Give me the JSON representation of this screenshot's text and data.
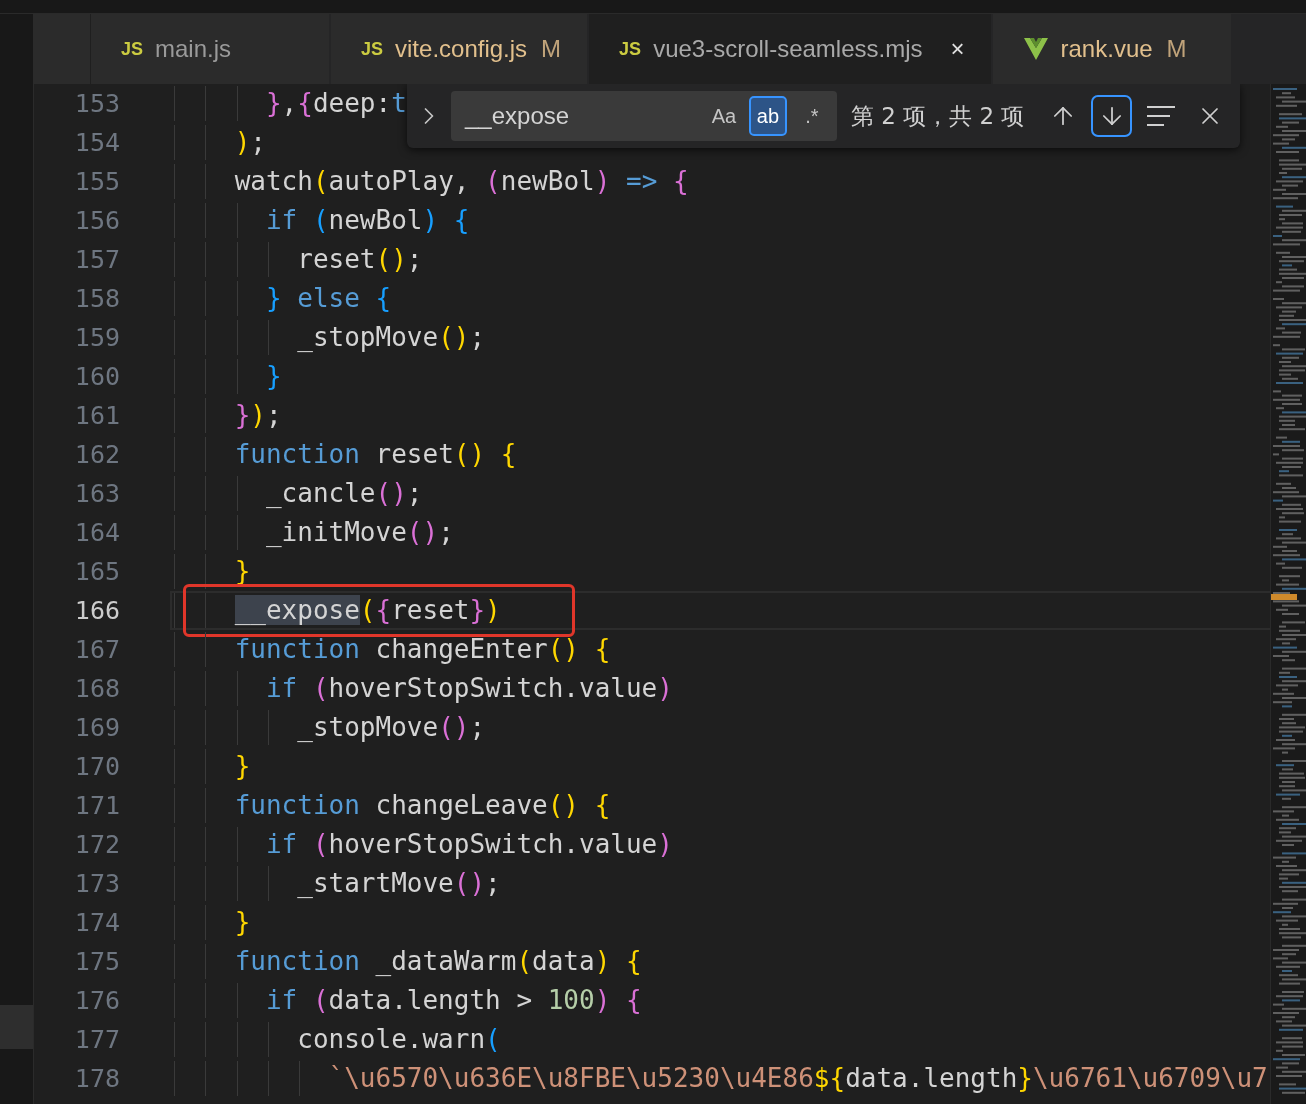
{
  "tabs": [
    {
      "kind": "js",
      "icon_text": "JS",
      "label": "main.js",
      "selected": false
    },
    {
      "kind": "js",
      "icon_text": "JS",
      "label": "vite.config.js",
      "badge": "M",
      "selected": false
    },
    {
      "kind": "js",
      "icon_text": "JS",
      "label": "vue3-scroll-seamless.mjs",
      "selected": true,
      "close": "×"
    },
    {
      "kind": "vue",
      "label": "rank.vue",
      "badge": "M",
      "selected": false
    }
  ],
  "find_widget": {
    "value": "__expose",
    "options": [
      {
        "label": "Aa",
        "selected": false
      },
      {
        "label": "ab",
        "selected": true
      },
      {
        "label": ".*",
        "selected": false
      }
    ],
    "match_count": "第 2 项，共 2 项",
    "buttons": [
      {
        "kind": "previous",
        "focused": false
      },
      {
        "kind": "next",
        "focused": true
      },
      {
        "kind": "selection",
        "focused": false
      },
      {
        "kind": "close",
        "focused": false
      }
    ]
  },
  "lines": [
    {
      "number": "153",
      "current": false,
      "tokens": [
        {
          "text": "      }",
          "kind": "p2"
        },
        {
          "text": ",",
          "kind": "t"
        },
        {
          "text": "{",
          "kind": "p2"
        },
        {
          "text": "deep:",
          "kind": "t"
        },
        {
          "text": "t",
          "kind": "k"
        }
      ]
    },
    {
      "number": "154",
      "current": false,
      "tokens": [
        {
          "text": "    )",
          "kind": "p1"
        },
        {
          "text": ";",
          "kind": "t"
        }
      ]
    },
    {
      "number": "155",
      "current": false,
      "tokens": [
        {
          "text": "    watch",
          "kind": "t"
        },
        {
          "text": "(",
          "kind": "p1"
        },
        {
          "text": "autoPlay, ",
          "kind": "t"
        },
        {
          "text": "(",
          "kind": "p2"
        },
        {
          "text": "newBol",
          "kind": "t"
        },
        {
          "text": ")",
          "kind": "p2"
        },
        {
          "text": " =>",
          "kind": "k"
        },
        {
          "text": " {",
          "kind": "p2"
        }
      ]
    },
    {
      "number": "156",
      "current": false,
      "tokens": [
        {
          "text": "      if",
          "kind": "k"
        },
        {
          "text": " (",
          "kind": "p3"
        },
        {
          "text": "newBol",
          "kind": "t"
        },
        {
          "text": ")",
          "kind": "p3"
        },
        {
          "text": " {",
          "kind": "p3"
        }
      ]
    },
    {
      "number": "157",
      "current": false,
      "tokens": [
        {
          "text": "        reset",
          "kind": "t"
        },
        {
          "text": "()",
          "kind": "p1"
        },
        {
          "text": ";",
          "kind": "t"
        }
      ]
    },
    {
      "number": "158",
      "current": false,
      "tokens": [
        {
          "text": "      }",
          "kind": "p3"
        },
        {
          "text": " else",
          "kind": "k"
        },
        {
          "text": " {",
          "kind": "p3"
        }
      ]
    },
    {
      "number": "159",
      "current": false,
      "tokens": [
        {
          "text": "        _stopMove",
          "kind": "t"
        },
        {
          "text": "()",
          "kind": "p1"
        },
        {
          "text": ";",
          "kind": "t"
        }
      ]
    },
    {
      "number": "160",
      "current": false,
      "tokens": [
        {
          "text": "      }",
          "kind": "p3"
        }
      ]
    },
    {
      "number": "161",
      "current": false,
      "tokens": [
        {
          "text": "    }",
          "kind": "p2"
        },
        {
          "text": ")",
          "kind": "p1"
        },
        {
          "text": ";",
          "kind": "t"
        }
      ]
    },
    {
      "number": "162",
      "current": false,
      "tokens": [
        {
          "text": "    function",
          "kind": "k"
        },
        {
          "text": " reset",
          "kind": "t"
        },
        {
          "text": "()",
          "kind": "p1"
        },
        {
          "text": " {",
          "kind": "p1"
        }
      ]
    },
    {
      "number": "163",
      "current": false,
      "tokens": [
        {
          "text": "      _cancle",
          "kind": "t"
        },
        {
          "text": "()",
          "kind": "p2"
        },
        {
          "text": ";",
          "kind": "t"
        }
      ]
    },
    {
      "number": "164",
      "current": false,
      "tokens": [
        {
          "text": "      _initMove",
          "kind": "t"
        },
        {
          "text": "()",
          "kind": "p2"
        },
        {
          "text": ";",
          "kind": "t"
        }
      ]
    },
    {
      "number": "165",
      "current": false,
      "tokens": [
        {
          "text": "    }",
          "kind": "p1"
        }
      ]
    },
    {
      "number": "166",
      "current": true,
      "annotated": true,
      "tokens": [
        {
          "text": "    __expose",
          "kind": "m"
        },
        {
          "text": "(",
          "kind": "p1"
        },
        {
          "text": "{",
          "kind": "p2"
        },
        {
          "text": "reset",
          "kind": "t"
        },
        {
          "text": "}",
          "kind": "p2"
        },
        {
          "text": ")",
          "kind": "p1"
        }
      ]
    },
    {
      "number": "167",
      "current": false,
      "tokens": [
        {
          "text": "    function",
          "kind": "k"
        },
        {
          "text": " changeEnter",
          "kind": "t"
        },
        {
          "text": "()",
          "kind": "p1"
        },
        {
          "text": " {",
          "kind": "p1"
        }
      ]
    },
    {
      "number": "168",
      "current": false,
      "tokens": [
        {
          "text": "      if",
          "kind": "k"
        },
        {
          "text": " (",
          "kind": "p2"
        },
        {
          "text": "hoverStopSwitch.value",
          "kind": "t"
        },
        {
          "text": ")",
          "kind": "p2"
        }
      ]
    },
    {
      "number": "169",
      "current": false,
      "tokens": [
        {
          "text": "        _stopMove",
          "kind": "t"
        },
        {
          "text": "()",
          "kind": "p2"
        },
        {
          "text": ";",
          "kind": "t"
        }
      ]
    },
    {
      "number": "170",
      "current": false,
      "tokens": [
        {
          "text": "    }",
          "kind": "p1"
        }
      ]
    },
    {
      "number": "171",
      "current": false,
      "tokens": [
        {
          "text": "    function",
          "kind": "k"
        },
        {
          "text": " changeLeave",
          "kind": "t"
        },
        {
          "text": "()",
          "kind": "p1"
        },
        {
          "text": " {",
          "kind": "p1"
        }
      ]
    },
    {
      "number": "172",
      "current": false,
      "tokens": [
        {
          "text": "      if",
          "kind": "k"
        },
        {
          "text": " (",
          "kind": "p2"
        },
        {
          "text": "hoverStopSwitch.value",
          "kind": "t"
        },
        {
          "text": ")",
          "kind": "p2"
        }
      ]
    },
    {
      "number": "173",
      "current": false,
      "tokens": [
        {
          "text": "        _startMove",
          "kind": "t"
        },
        {
          "text": "()",
          "kind": "p2"
        },
        {
          "text": ";",
          "kind": "t"
        }
      ]
    },
    {
      "number": "174",
      "current": false,
      "tokens": [
        {
          "text": "    }",
          "kind": "p1"
        }
      ]
    },
    {
      "number": "175",
      "current": false,
      "tokens": [
        {
          "text": "    function",
          "kind": "k"
        },
        {
          "text": " _dataWarm",
          "kind": "t"
        },
        {
          "text": "(",
          "kind": "p1"
        },
        {
          "text": "data",
          "kind": "t"
        },
        {
          "text": ")",
          "kind": "p1"
        },
        {
          "text": " {",
          "kind": "p1"
        }
      ]
    },
    {
      "number": "176",
      "current": false,
      "tokens": [
        {
          "text": "      if",
          "kind": "k"
        },
        {
          "text": " (",
          "kind": "p2"
        },
        {
          "text": "data.length > ",
          "kind": "t"
        },
        {
          "text": "100",
          "kind": "n"
        },
        {
          "text": ")",
          "kind": "p2"
        },
        {
          "text": " {",
          "kind": "p2"
        }
      ]
    },
    {
      "number": "177",
      "current": false,
      "tokens": [
        {
          "text": "        console.warn",
          "kind": "t"
        },
        {
          "text": "(",
          "kind": "p3"
        }
      ]
    },
    {
      "number": "178",
      "current": false,
      "tokens": [
        {
          "text": "          `\\u6570\\u636E\\u8FBE\\u5230\\u4E86",
          "kind": "s"
        },
        {
          "text": "${",
          "kind": "p1"
        },
        {
          "text": "data.length",
          "kind": "t"
        },
        {
          "text": "}",
          "kind": "p1"
        },
        {
          "text": "\\u6761\\u6709\\u7",
          "kind": "s"
        }
      ]
    }
  ]
}
